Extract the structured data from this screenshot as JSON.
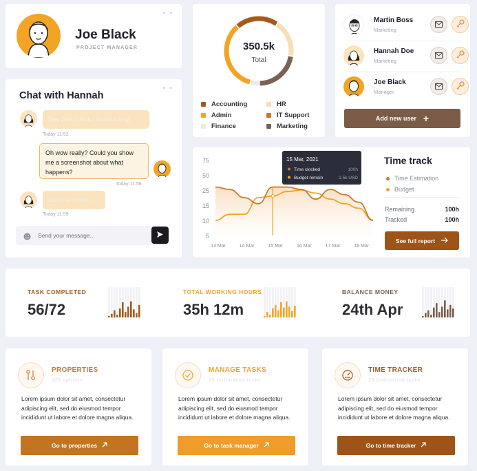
{
  "profile": {
    "name": "Joe Black",
    "role": "PROJECT MANAGER"
  },
  "donut": {
    "total_value": "350.5k",
    "total_label": "Total",
    "legend": [
      {
        "label": "Accounting",
        "color": "#a55a1c"
      },
      {
        "label": "HR",
        "color": "#f7deb8"
      },
      {
        "label": "Admin",
        "color": "#f2a424"
      },
      {
        "label": "IT Support",
        "color": "#c77b2f"
      },
      {
        "label": "Finance",
        "color": "#ebebee"
      },
      {
        "label": "Marketing",
        "color": "#7a6252"
      }
    ]
  },
  "users": {
    "list": [
      {
        "name": "Martin Boss",
        "role": "Marketing"
      },
      {
        "name": "Hannah Doe",
        "role": "Marketing"
      },
      {
        "name": "Joe Black",
        "role": "Manager"
      }
    ],
    "add_label": "Add new user"
  },
  "chat": {
    "title": "Chat with Hannah",
    "messages": [
      {
        "text": "Hey Joe! I think I found a bug!",
        "time": "Today 11:52"
      },
      {
        "text": "Oh wow really? Could you show me a screenshot about what happens?",
        "time": "Today 11:58"
      },
      {
        "text": "Sure! One sec...",
        "time": "Today 11:59"
      }
    ],
    "placeholder": "Send your message..."
  },
  "time_track": {
    "title": "Time track",
    "legend": [
      {
        "label": "Time Estimation",
        "color": "#c77b2f"
      },
      {
        "label": "Budget",
        "color": "#f2a424"
      }
    ],
    "remaining_label": "Remaining",
    "remaining_value": "100h",
    "tracked_label": "Tracked",
    "tracked_value": "100h",
    "button": "See full report",
    "tooltip": {
      "date": "15 Mar, 2021",
      "rows": [
        {
          "label": "Time clocked",
          "value": "100h",
          "color": "#c77b2f"
        },
        {
          "label": "Budget remain",
          "value": "1.5k USD",
          "color": "#f2a424"
        }
      ]
    }
  },
  "chart_data": {
    "type": "line",
    "x": [
      "13 Mar",
      "13.5",
      "14 Mar",
      "14.5",
      "15 Mar",
      "15.5",
      "16 Mar",
      "16.5",
      "17 Mar",
      "17.5",
      "18 Mar",
      "18.5"
    ],
    "x_ticks": [
      "13 Mar",
      "14 Mar",
      "15 Mar",
      "16 Mar",
      "17 Mar",
      "18 Mar"
    ],
    "y_ticks": [
      75,
      50,
      25,
      15,
      10,
      5
    ],
    "series": [
      {
        "name": "Time clocked",
        "color": "#c77b2f",
        "values": [
          30,
          26,
          20,
          16,
          30,
          30,
          26,
          19,
          26,
          22,
          17,
          10
        ]
      },
      {
        "name": "Budget remain",
        "color": "#f2a424",
        "values": [
          10,
          12,
          12,
          20,
          21,
          24,
          25,
          23,
          19,
          16,
          14,
          10
        ]
      }
    ],
    "highlight_x": "15 Mar"
  },
  "stats": [
    {
      "label": "TASK COMPLETED",
      "value": "56/72",
      "color": "#a55a1c",
      "bars": [
        0.05,
        0.2,
        0.4,
        0.15,
        0.5,
        0.85,
        0.3,
        0.6,
        0.9,
        0.45,
        0.25,
        0.7
      ]
    },
    {
      "label": "TOTAL WORKING HOURS",
      "value": "35h 12m",
      "color": "#f2a424",
      "bars": [
        0.05,
        0.3,
        0.15,
        0.5,
        0.7,
        0.4,
        0.85,
        0.55,
        0.9,
        0.6,
        0.35,
        0.65
      ]
    },
    {
      "label": "BALANCE MONEY",
      "value": "24th Apr",
      "color": "#7a5c49",
      "bars": [
        0.05,
        0.25,
        0.4,
        0.15,
        0.55,
        0.8,
        0.3,
        0.6,
        0.95,
        0.45,
        0.7,
        0.5
      ]
    }
  ],
  "features": [
    {
      "title": "PROPERTIES",
      "sub": "128 options",
      "desc": "Lorem ipsum dolor sit amet, consectetur adipiscing elit, sed do eiusmod tempor incididunt ut labore et dolore magna aliqua.",
      "button": "Go to properties",
      "color": "#c77b2f",
      "btn_color": "#c2741f",
      "icon": "properties-icon"
    },
    {
      "title": "MANAGE TASKS",
      "sub": "23 Unfinished tasks",
      "desc": "Lorem ipsum dolor sit amet, consectetur adipiscing elit, sed do eiusmod tempor incididunt ut labore et dolore magna aliqua.",
      "button": "Go to task manager",
      "color": "#f2a424",
      "btn_color": "#f09c2c",
      "icon": "check-circle-icon"
    },
    {
      "title": "TIME TRACKER",
      "sub": "23 Unfinished tasks",
      "desc": "Lorem ipsum dolor sit amet, consectetur adipiscing elit, sed do eiusmod tempor incididunt ut labore et dolore magna aliqua.",
      "button": "Go to time tracker",
      "color": "#a55a1c",
      "btn_color": "#9e5417",
      "icon": "gauge-icon"
    }
  ]
}
